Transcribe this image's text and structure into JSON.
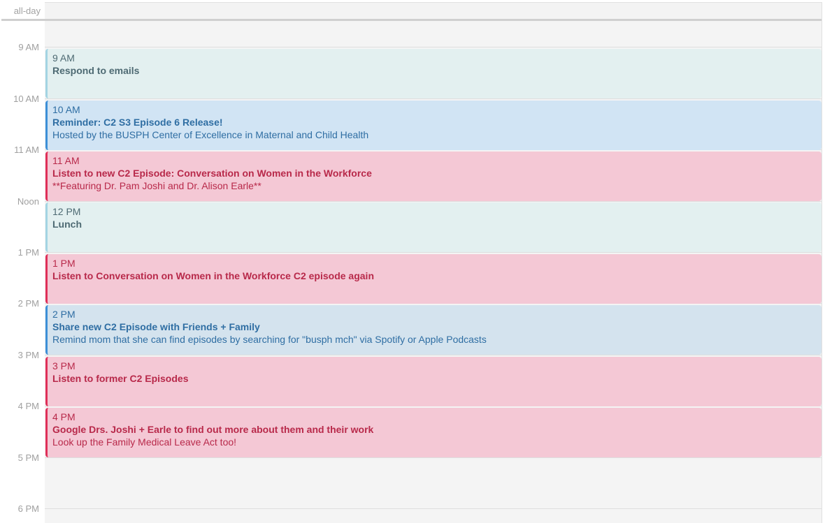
{
  "allday_label": "all-day",
  "hours": [
    "9 AM",
    "10 AM",
    "11 AM",
    "Noon",
    "1 PM",
    "2 PM",
    "3 PM",
    "4 PM",
    "5 PM",
    "6 PM"
  ],
  "events": [
    {
      "time": "9 AM",
      "title": "Respond to emails",
      "note": "",
      "color": "teal"
    },
    {
      "time": "10 AM",
      "title": "Reminder: C2 S3 Episode 6 Release!",
      "note": "Hosted by the BUSPH Center of Excellence in Maternal and Child Health",
      "color": "blue"
    },
    {
      "time": "11 AM",
      "title": "Listen to new C2 Episode: Conversation on Women in the Workforce",
      "note": "**Featuring Dr. Pam Joshi and Dr. Alison Earle**",
      "color": "pink"
    },
    {
      "time": "12 PM",
      "title": "Lunch",
      "note": "",
      "color": "teal"
    },
    {
      "time": "1 PM",
      "title": "Listen to Conversation on Women in the Workforce C2 episode again",
      "note": "",
      "color": "pink"
    },
    {
      "time": "2 PM",
      "title": "Share new C2 Episode with Friends + Family",
      "note": "Remind mom that she can find episodes by searching for \"busph mch\" via Spotify or Apple Podcasts",
      "color": "blue"
    },
    {
      "time": "3 PM",
      "title": "Listen to former C2 Episodes",
      "note": "",
      "color": "pink"
    },
    {
      "time": "4 PM",
      "title": "Google Drs. Joshi + Earle to find out more about them and their work",
      "note": "Look up the Family Medical Leave Act too!",
      "color": "pink"
    }
  ],
  "colors": {
    "teal": "#e3f0f0",
    "blue": "#d1e4f4",
    "pink": "#f4c8d5"
  }
}
